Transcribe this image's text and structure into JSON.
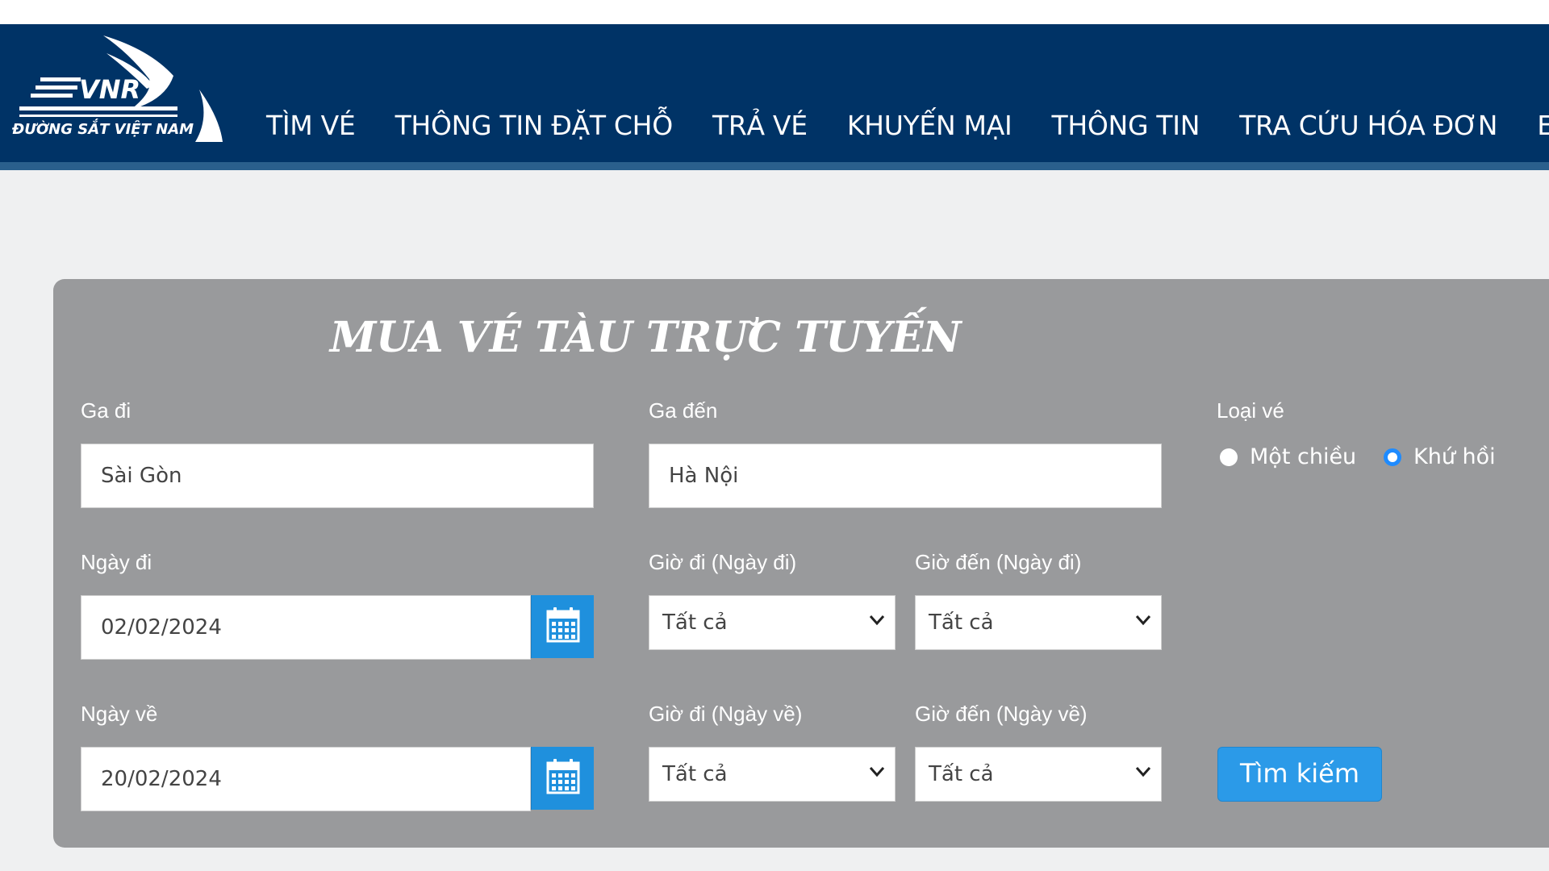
{
  "header": {
    "logo_text": "VNR",
    "logo_subtitle": "ĐƯỜNG SẮT VIỆT NAM",
    "nav": [
      "TÌM VÉ",
      "THÔNG TIN ĐẶT CHỖ",
      "TRẢ VÉ",
      "KHUYẾN MẠI",
      "THÔNG TIN",
      "TRA CỨU HÓA ĐƠN",
      "ENG"
    ],
    "colors": {
      "navbar": "#003366",
      "navbar_border": "#2a5f8c"
    }
  },
  "form": {
    "title": "MUA VÉ TÀU TRỰC TUYẾN",
    "from_label": "Ga đi",
    "from_value": "Sài Gòn",
    "to_label": "Ga đến",
    "to_value": "Hà Nội",
    "ticket_type_label": "Loại vé",
    "ticket_types": [
      {
        "label": "Một chiều",
        "selected": false
      },
      {
        "label": "Khứ hồi",
        "selected": true
      }
    ],
    "depart_date_label": "Ngày đi",
    "depart_date": "02/02/2024",
    "depart_time_label": "Giờ đi (Ngày đi)",
    "depart_time_value": "Tất cả",
    "depart_arrive_label": "Giờ đến (Ngày đi)",
    "depart_arrive_value": "Tất cả",
    "return_date_label": "Ngày về",
    "return_date": "20/02/2024",
    "return_time_label": "Giờ đi (Ngày về)",
    "return_time_value": "Tất cả",
    "return_arrive_label": "Giờ đến (Ngày về)",
    "return_arrive_value": "Tất cả",
    "search_label": "Tìm kiếm",
    "icons": [
      "calendar-icon",
      "chevron-down-icon"
    ],
    "colors": {
      "panel": "#999a9c",
      "button": "#2b9ae8",
      "radio_on": "#1e8bff"
    }
  }
}
